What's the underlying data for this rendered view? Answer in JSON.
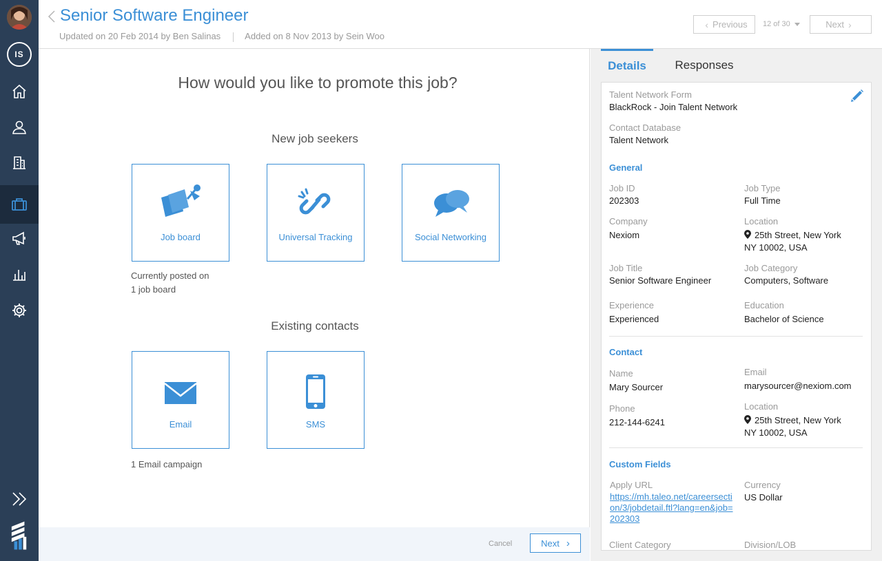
{
  "sidebar": {
    "initials": "IS",
    "items": [
      {
        "name": "home-icon"
      },
      {
        "name": "user-icon"
      },
      {
        "name": "building-icon"
      },
      {
        "name": "briefcase-icon",
        "active": true
      },
      {
        "name": "megaphone-icon"
      },
      {
        "name": "bar-chart-icon"
      },
      {
        "name": "gear-icon"
      }
    ]
  },
  "header": {
    "title": "Senior Software Engineer",
    "updated": "Updated on 20 Feb 2014 by Ben Salinas",
    "added": "Added on 8 Nov 2013 by Sein Woo",
    "pager": {
      "previous": "Previous",
      "count": "12 of 30",
      "next": "Next"
    }
  },
  "main": {
    "heading": "How would you like to promote this job?",
    "new_seekers": "New job seekers",
    "existing": "Existing contacts",
    "tiles": {
      "job_board": "Job board",
      "tracking": "Universal Tracking",
      "social": "Social Networking",
      "email": "Email",
      "sms": "SMS"
    },
    "posted_line1": "Currently posted on",
    "posted_line2": "1 job board",
    "email_note": "1 Email campaign",
    "footer": {
      "cancel": "Cancel",
      "next": "Next"
    }
  },
  "panel": {
    "tabs": {
      "details": "Details",
      "responses": "Responses"
    },
    "talent_form_k": "Talent Network Form",
    "talent_form_v": "BlackRock - Join Talent Network",
    "contact_db_k": "Contact Database",
    "contact_db_v": "Talent Network",
    "general": "General",
    "job_id_k": "Job ID",
    "job_id_v": "202303",
    "job_type_k": "Job Type",
    "job_type_v": "Full Time",
    "company_k": "Company",
    "company_v": "Nexiom",
    "location_k": "Location",
    "location_v1": "25th Street, New York",
    "location_v2": "NY 10002, USA",
    "job_title_k": "Job Title",
    "job_title_v": "Senior Software Engineer",
    "job_cat_k": "Job Category",
    "job_cat_v": "Computers, Software",
    "experience_k": "Experience",
    "experience_v": "Experienced",
    "education_k": "Education",
    "education_v": "Bachelor of Science",
    "contact": "Contact",
    "name_k": "Name",
    "name_v": "Mary Sourcer",
    "email_k": "Email",
    "email_v": "marysourcer@nexiom.com",
    "phone_k": "Phone",
    "phone_v": "212-144-6241",
    "c_location_k": "Location",
    "c_location_v1": "25th Street, New York",
    "c_location_v2": "NY 10002, USA",
    "custom": "Custom Fields",
    "apply_k": "Apply URL",
    "apply_v": "https://mh.taleo.net/careersection/3/jobdetail.ftl?lang=en&job=202303",
    "currency_k": "Currency",
    "currency_v": "US Dollar",
    "client_cat_k": "Client Category",
    "division_k": "Division/LOB"
  }
}
